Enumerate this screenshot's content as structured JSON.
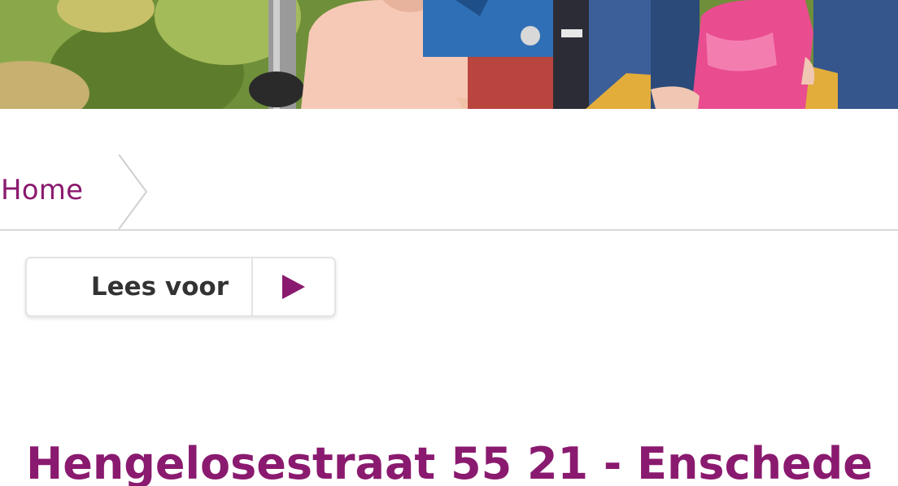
{
  "breadcrumb": {
    "home_label": "Home"
  },
  "readspeaker": {
    "label": "Lees voor",
    "play_icon": "play-icon"
  },
  "page": {
    "title": "Hengelosestraat 55 21 - Enschede"
  },
  "colors": {
    "brand": "#8a1a6f",
    "text_dark": "#333333",
    "divider": "#d9d9d9"
  }
}
